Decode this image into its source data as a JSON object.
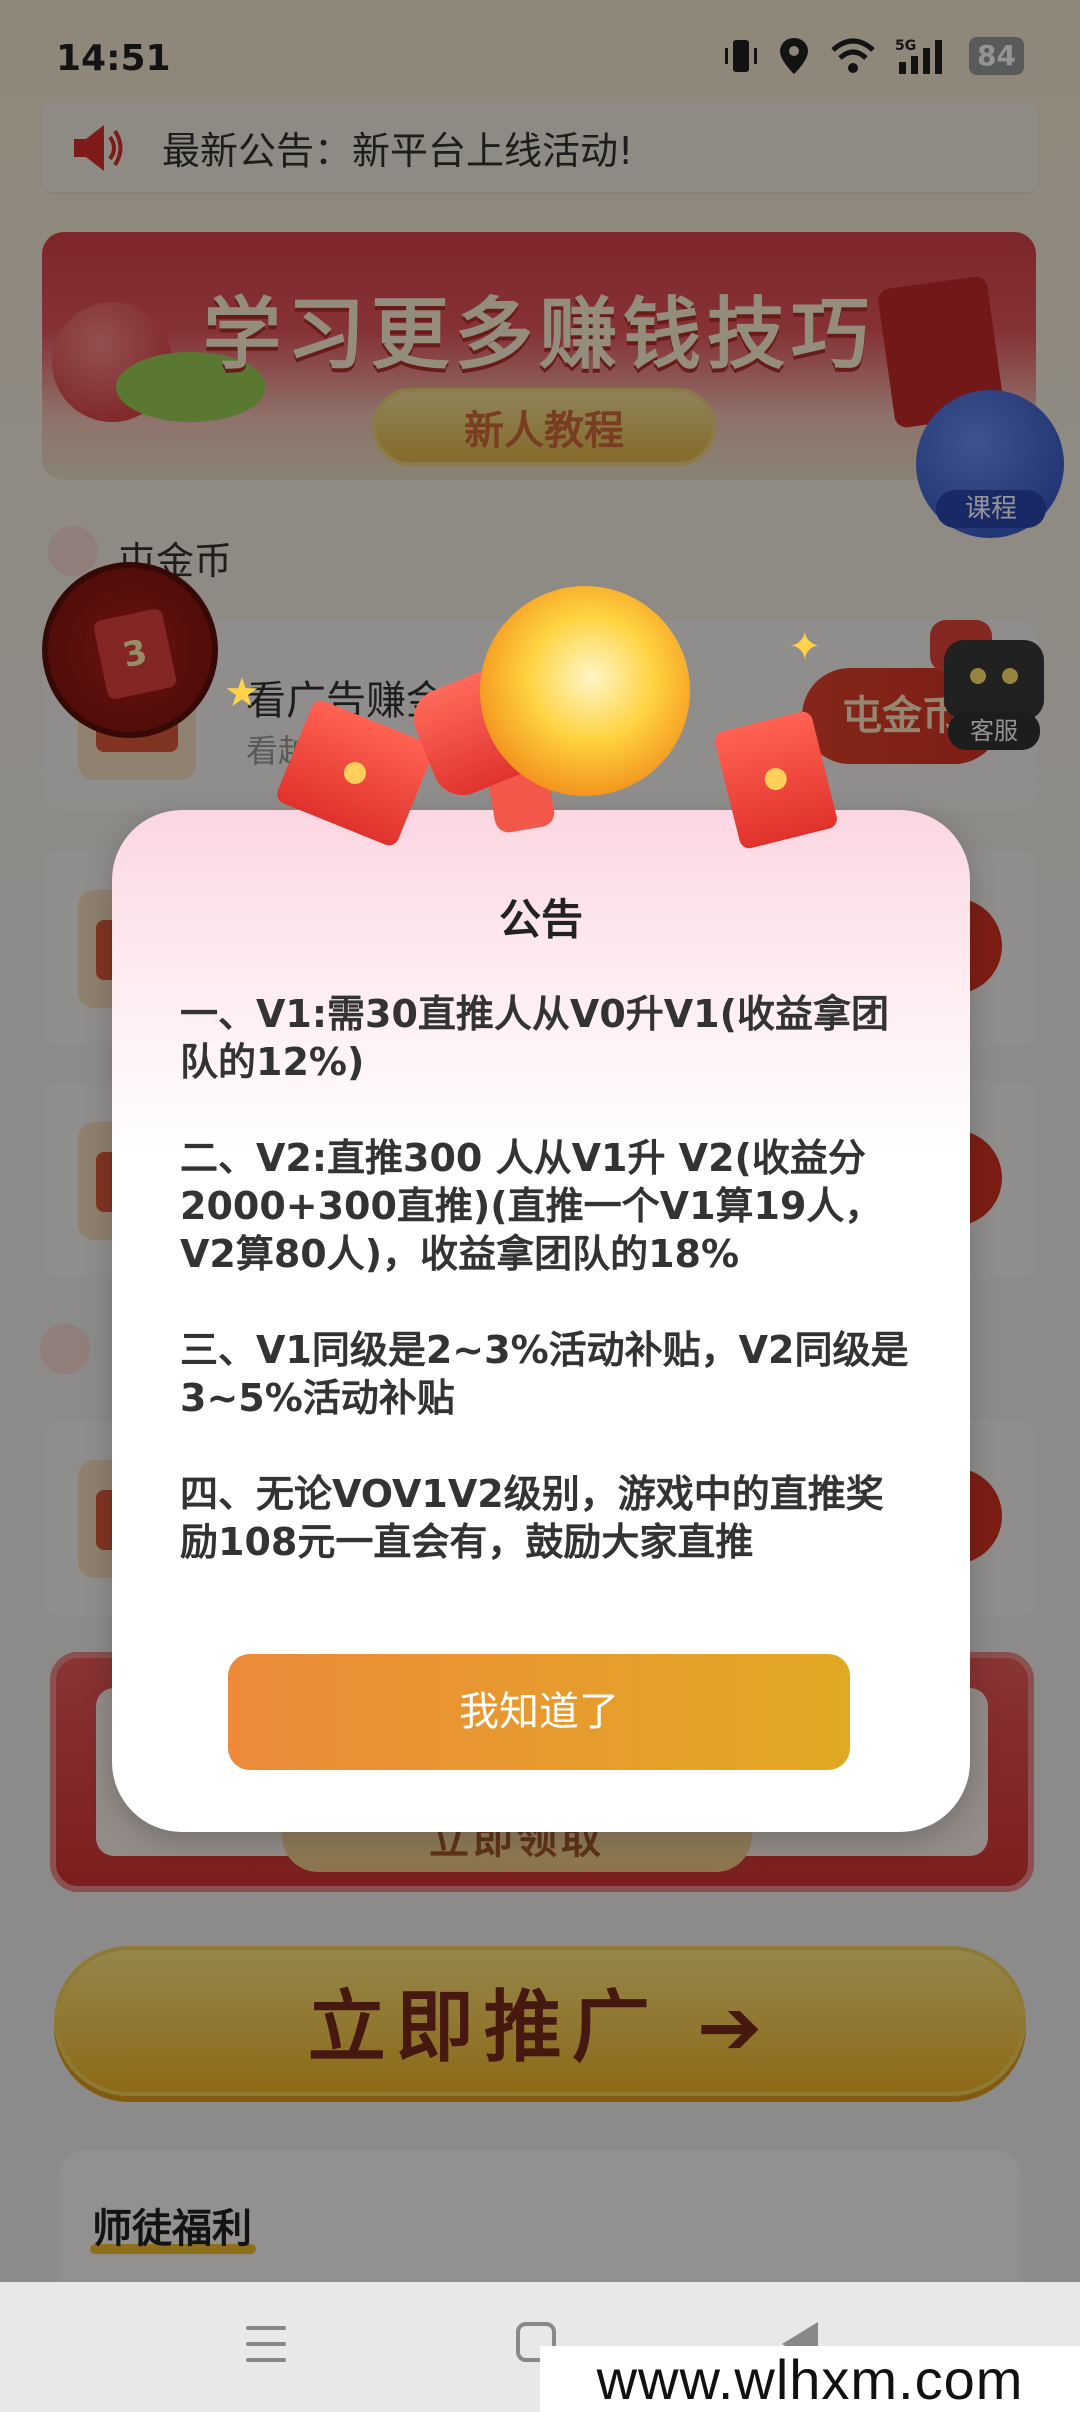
{
  "status_bar": {
    "time": "14:51",
    "battery": "84",
    "icons": [
      "vibrate-icon",
      "location-icon",
      "wifi-icon",
      "signal-5g-icon",
      "battery-icon"
    ]
  },
  "notice": {
    "text": "最新公告：新平台上线活动!",
    "icon": "speaker-icon"
  },
  "banner": {
    "title": "学习更多赚钱技巧",
    "button": "新人教程"
  },
  "course_float": {
    "label": "课程"
  },
  "section_1": {
    "title": "屯金币"
  },
  "task_card": {
    "title": "看广告赚金",
    "subtitle": "看越",
    "button": "屯金币"
  },
  "red_float": {
    "number": "3"
  },
  "service_float": {
    "label": "客服"
  },
  "reward_banner": {
    "button": "立即领取"
  },
  "promote": {
    "label": "立即推广 ➔"
  },
  "mentor": {
    "title": "师徒福利"
  },
  "watermark": "www.wlhxm.com",
  "dialog": {
    "title": "公告",
    "paragraphs": [
      "一、V1:需30直推人从V0升V1(收益拿团队的12%)",
      "二、V2:直推300 人从V1升 V2(收益分2000+300直推)(直推一个V1算19人，V2算80人)，收益拿团队的18%",
      "三、V1同级是2~3%活动补贴，V2同级是3~5%活动补贴",
      "四、无论VOV1V2级别，游戏中的直推奖励108元一直会有，鼓励大家直推"
    ],
    "confirm": "我知道了"
  },
  "colors": {
    "accent_red": "#d53322",
    "accent_gold": "#f5b82a",
    "dialog_button_start": "#ec8a3a",
    "dialog_button_end": "#e2a923"
  }
}
